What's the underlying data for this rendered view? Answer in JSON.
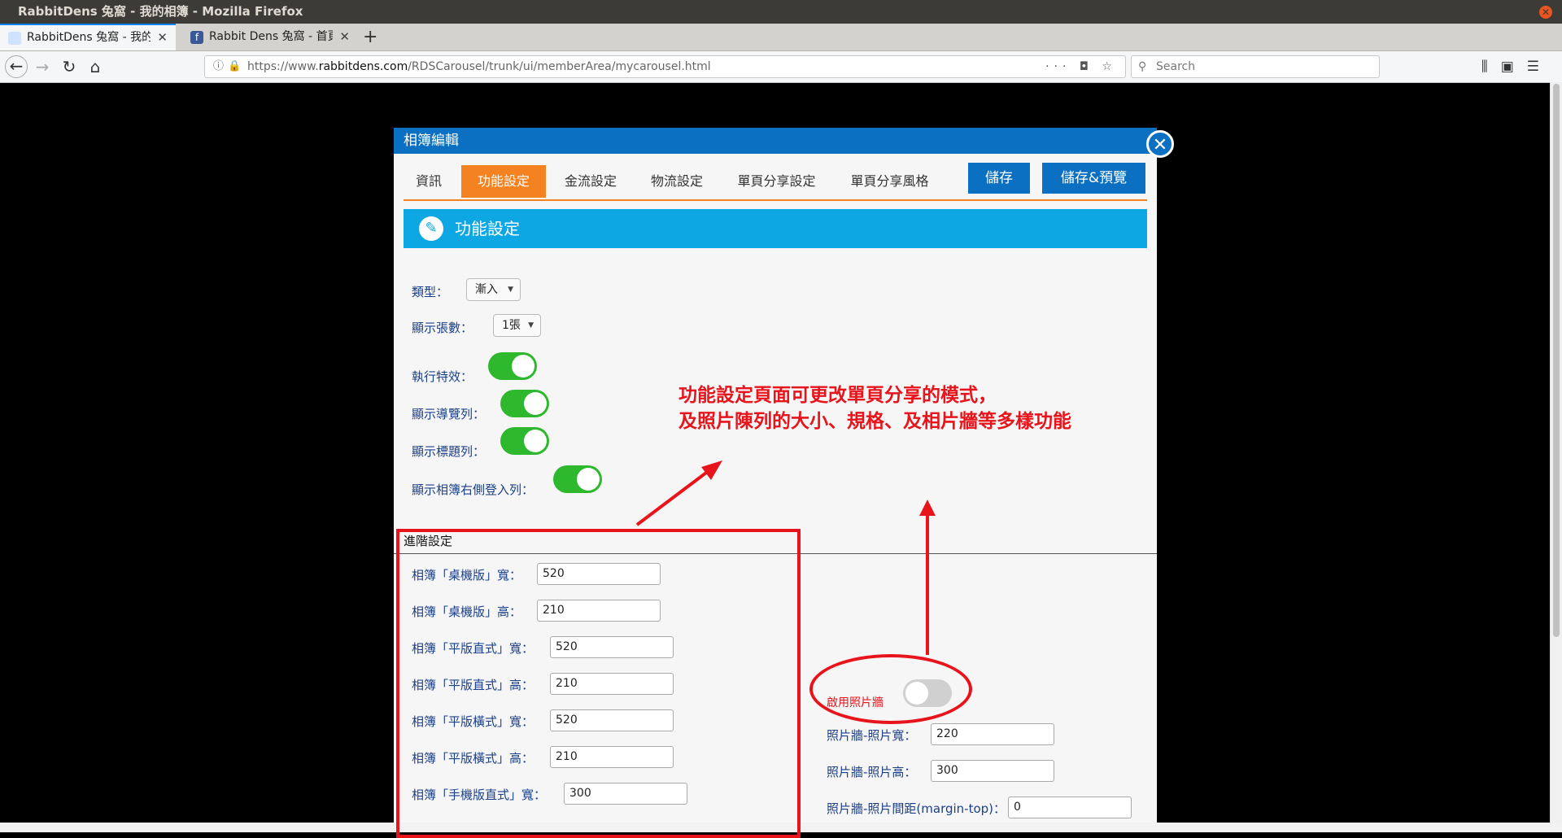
{
  "window": {
    "title": "RabbitDens 兔窩 - 我的相簿 - Mozilla Firefox"
  },
  "tabs": [
    {
      "title": "RabbitDens 兔窩 - 我的相",
      "active": true
    },
    {
      "title": "Rabbit Dens 兔窩 - 首頁",
      "active": false
    }
  ],
  "nav": {
    "url_prefix": "https://www.",
    "url_domain": "rabbitdens.com",
    "url_path": "/RDSCarousel/trunk/ui/memberArea/mycarousel.html",
    "search_placeholder": "Search"
  },
  "modal": {
    "title": "相簿編輯",
    "tabs": [
      "資訊",
      "功能設定",
      "金流設定",
      "物流設定",
      "單頁分享設定",
      "單頁分享風格"
    ],
    "active_tab": "功能設定",
    "save": "儲存",
    "save_preview": "儲存&預覽",
    "section_title": "功能設定"
  },
  "settings": {
    "type_label": "類型：",
    "type_value": "漸入",
    "count_label": "顯示張數：",
    "count_value": "1張",
    "effect_label": "執行特效：",
    "nav_label": "顯示導覽列：",
    "titlebar_label": "顯示標題列：",
    "login_label": "顯示相簿右側登入列：",
    "toggles": {
      "effect": true,
      "nav": true,
      "titlebar": true,
      "login": true
    }
  },
  "advanced": {
    "title": "進階設定",
    "fields": [
      {
        "label": "相簿「桌機版」寬：",
        "value": "520"
      },
      {
        "label": "相簿「桌機版」高：",
        "value": "210"
      },
      {
        "label": "相簿「平版直式」寬：",
        "value": "520"
      },
      {
        "label": "相簿「平版直式」高：",
        "value": "210"
      },
      {
        "label": "相簿「平版橫式」寬：",
        "value": "520"
      },
      {
        "label": "相簿「平版橫式」高：",
        "value": "210"
      },
      {
        "label": "相簿「手機版直式」寬：",
        "value": "300"
      }
    ],
    "photowall_label": "啟用照片牆",
    "photowall_enabled": false,
    "wall_fields": [
      {
        "label": "照片牆-照片寬：",
        "value": "220"
      },
      {
        "label": "照片牆-照片高：",
        "value": "300"
      },
      {
        "label": "照片牆-照片間距(margin-top)：",
        "value": "0"
      }
    ]
  },
  "annotation": {
    "line1": "功能設定頁面可更改單頁分享的模式，",
    "line2": "及照片陳列的大小、規格、及相片牆等多樣功能"
  },
  "colors": {
    "brand_blue": "#0b6fc2",
    "orange": "#f58220",
    "banner": "#0da8e3",
    "toggle_on": "#2eb82e",
    "annotation_red": "#e8141b"
  }
}
